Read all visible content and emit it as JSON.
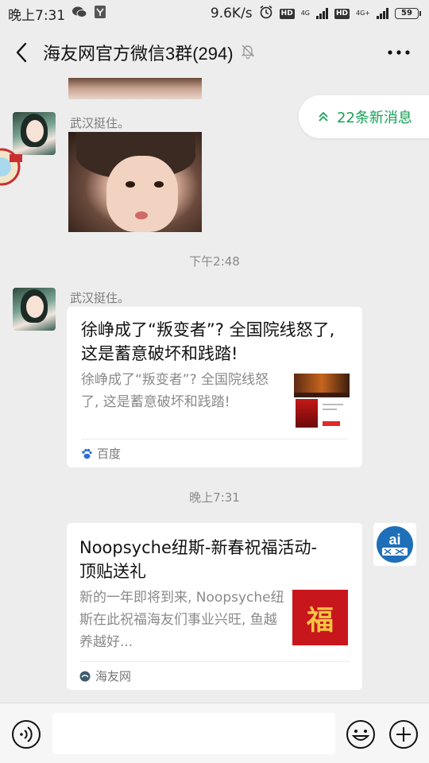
{
  "status_bar": {
    "time": "晚上7:31",
    "net_speed": "9.6K/s",
    "hd1": "HD",
    "net1": "4G",
    "hd2": "HD",
    "net2": "4G+",
    "battery": "59"
  },
  "header": {
    "title": "海友网官方微信3群(294)"
  },
  "new_messages": {
    "label": "22条新消息",
    "accent": "#16a156"
  },
  "messages": [
    {
      "sender": "武汉挺住。",
      "type": "image"
    },
    {
      "timestamp": "下午2:48"
    },
    {
      "sender": "武汉挺住。",
      "type": "link",
      "title": "徐峥成了“叛变者”? 全国院线怒了, 这是蓄意破坏和践踏!",
      "desc": "徐峥成了“叛变者”? 全国院线怒了, 这是蓄意破坏和践踏!",
      "source": "百度"
    },
    {
      "timestamp": "晚上7:31"
    },
    {
      "type": "link",
      "title": "Noopsyche纽斯-新春祝福活动-顶贴送礼",
      "desc": "新的一年即将到来, Noopsyche纽斯在此祝福海友们事业兴旺, 鱼越养越好...",
      "source": "海友网",
      "thumb_text": "福"
    }
  ]
}
